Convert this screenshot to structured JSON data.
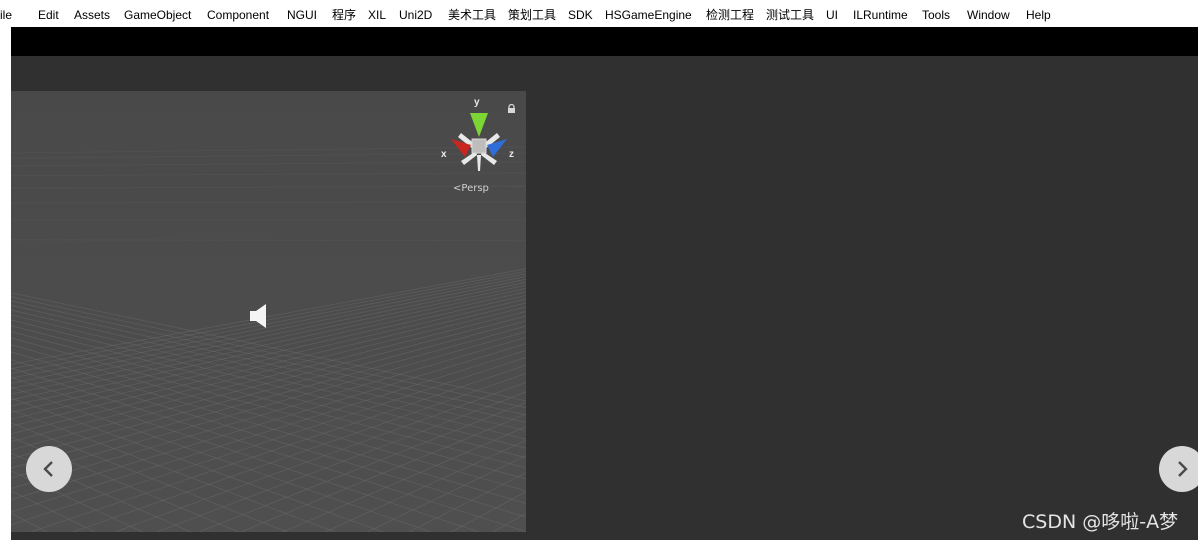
{
  "menubar": {
    "items": [
      "ile",
      "Edit",
      "Assets",
      "GameObject",
      "Component",
      "NGUI",
      "程序",
      "XIL",
      "Uni2D",
      "美术工具",
      "策划工具",
      "SDK",
      "HSGameEngine",
      "检测工程",
      "测试工具",
      "UI",
      "ILRuntime",
      "Tools",
      "Window",
      "Help"
    ]
  },
  "scene": {
    "gizmo": {
      "axis_y": "y",
      "axis_x": "x",
      "axis_z": "z",
      "lock_icon": "lock-icon"
    },
    "projection_label": "Persp",
    "audio_icon": "speaker-icon"
  },
  "viewer": {
    "prev_icon": "chevron-left-icon",
    "next_icon": "chevron-right-icon"
  },
  "watermark": "CSDN @哆啦-A梦",
  "colors": {
    "menubar_bg": "#ffffff",
    "editor_bg": "#303030",
    "scene_bg": "#4c4c4c",
    "axis_y": "#7cd435",
    "axis_x": "#c8261f",
    "axis_z": "#2f6ed8"
  }
}
